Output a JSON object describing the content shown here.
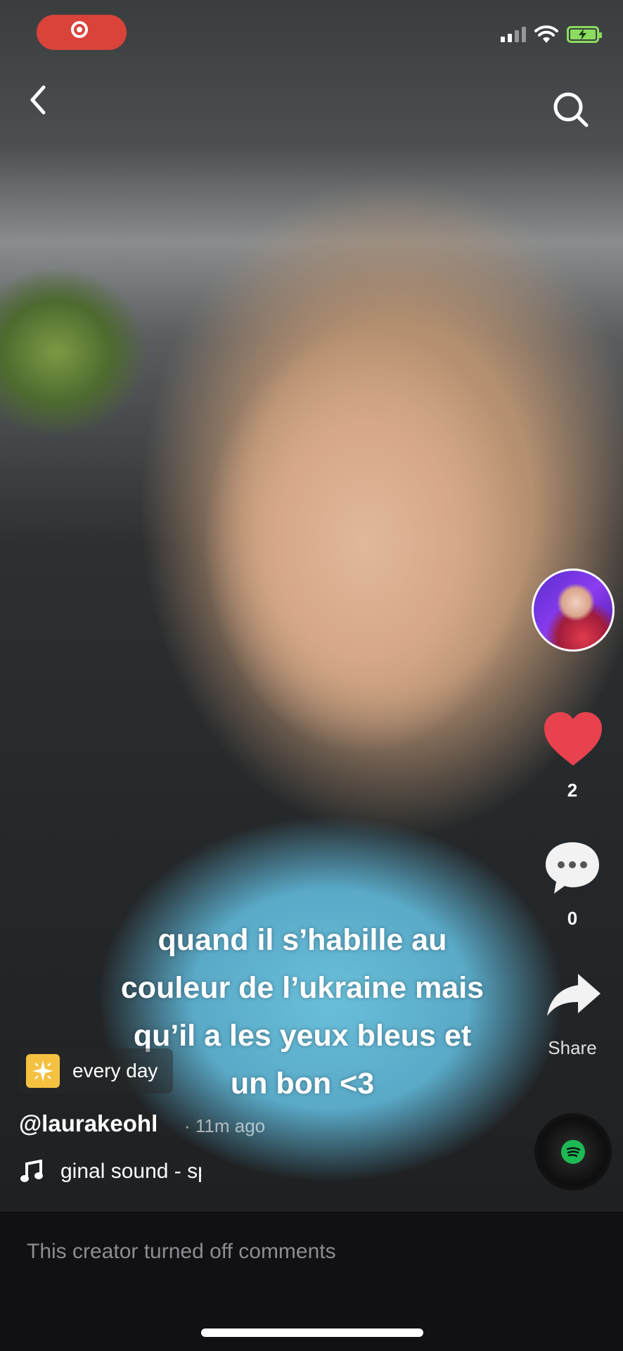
{
  "status_bar": {
    "record_indicator": "record-icon",
    "signal_icon": "cellular-signal-icon",
    "wifi_icon": "wifi-icon",
    "battery_icon": "battery-charging-icon",
    "battery_color": "#8bdc5f"
  },
  "header": {
    "back_icon": "chevron-left-icon",
    "search_icon": "search-icon"
  },
  "video": {
    "caption_lines": [
      "quand il s’habille au",
      "couleur de l’ukraine mais",
      "qu’il a les yeux bleus et",
      "un bon <3"
    ]
  },
  "side_rail": {
    "like_count": "2",
    "comment_count": "0",
    "share_label": "Share",
    "like_color": "#e8424f"
  },
  "post": {
    "tag_label": "every day",
    "username": "@laurakeohl",
    "time_ago": "· 11m ago",
    "sound": "ginal sound - speed.songg"
  },
  "footer": {
    "comments_notice": "This creator turned off comments"
  },
  "colors": {
    "record_red": "#d9433a",
    "background": "#111114",
    "spotify_green": "#1db954"
  }
}
